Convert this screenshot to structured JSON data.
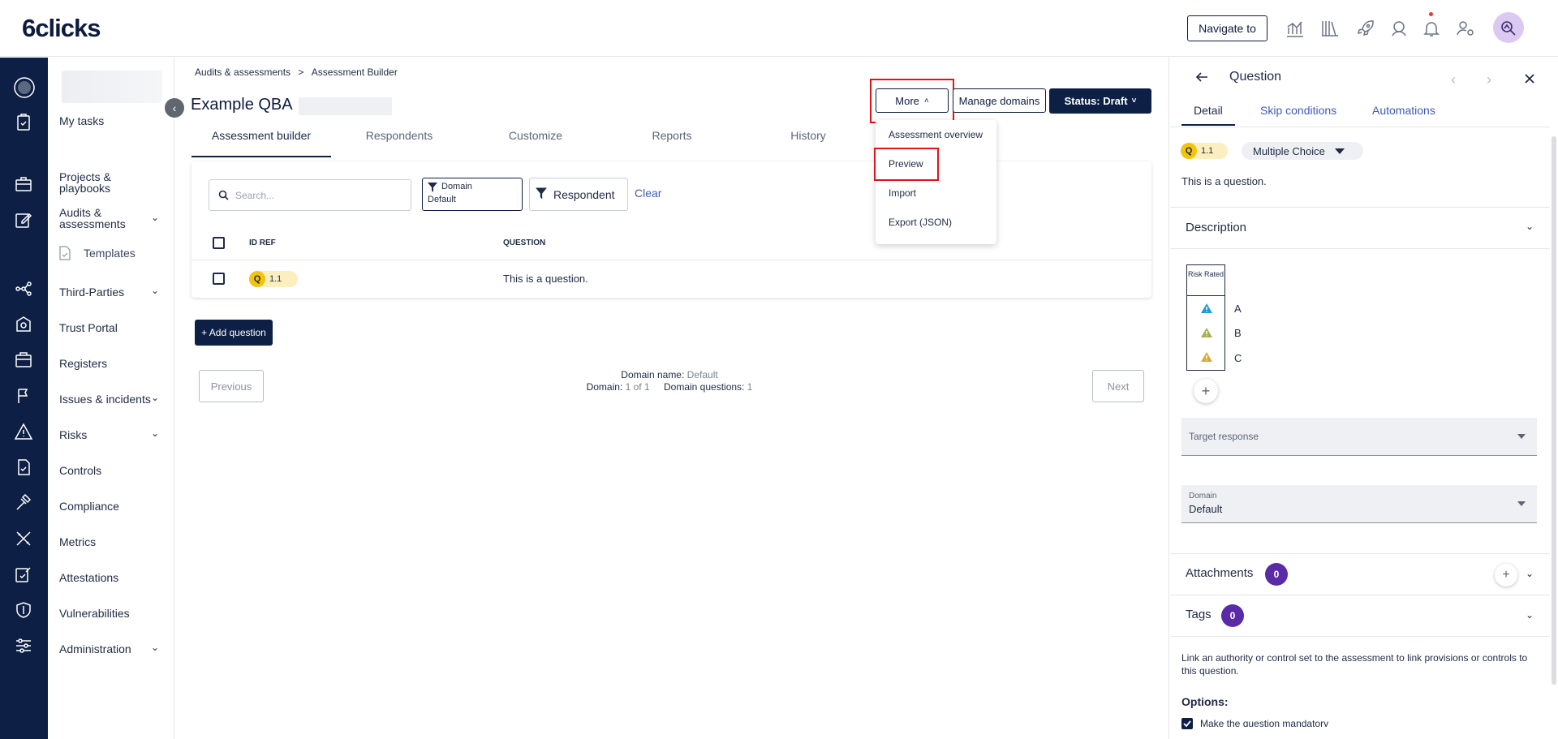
{
  "header": {
    "logo": "6clicks",
    "navigate_label": "Navigate to"
  },
  "menu": {
    "my_tasks": "My tasks",
    "projects": "Projects & playbooks",
    "audits": "Audits & assessments",
    "templates": "Templates",
    "third_parties": "Third-Parties",
    "trust_portal": "Trust Portal",
    "registers": "Registers",
    "issues": "Issues & incidents",
    "risks": "Risks",
    "controls": "Controls",
    "compliance": "Compliance",
    "metrics": "Metrics",
    "attestations": "Attestations",
    "vulnerabilities": "Vulnerabilities",
    "administration": "Administration"
  },
  "breadcrumb": {
    "parent": "Audits & assessments",
    "separator": ">",
    "current": "Assessment Builder"
  },
  "page": {
    "title": "Example QBA",
    "more_label": "More",
    "manage_domains_label": "Manage domains",
    "status_label": "Status: Draft"
  },
  "tabs": [
    "Assessment builder",
    "Respondents",
    "Customize",
    "Reports",
    "History"
  ],
  "filters": {
    "search_placeholder": "Search...",
    "domain_label": "Domain",
    "domain_value": "Default",
    "respondent_label": "Respondent",
    "clear_label": "Clear"
  },
  "table": {
    "columns": [
      "ID REF",
      "QUESTION"
    ],
    "rows": [
      {
        "badge": "Q",
        "id": "1.1",
        "question": "This is a question."
      }
    ]
  },
  "add_question_label": "+ Add question",
  "pagination": {
    "previous": "Previous",
    "next": "Next",
    "domain_name_label": "Domain name:",
    "domain_name_value": "Default",
    "domain_label": "Domain:",
    "domain_value": "1 of 1",
    "domain_questions_label": "Domain questions:",
    "domain_questions_value": "1"
  },
  "more_menu": {
    "items": [
      "Assessment overview",
      "Preview",
      "Import",
      "Export (JSON)"
    ]
  },
  "panel": {
    "title": "Question",
    "tabs": [
      "Detail",
      "Skip conditions",
      "Automations"
    ],
    "badge": "Q",
    "id": "1.1",
    "question_type": "Multiple Choice",
    "question_text": "This is a question.",
    "description_label": "Description",
    "risk_rated_label": "Risk Rated",
    "answers": [
      "A",
      "B",
      "C"
    ],
    "answer_icon_colors": [
      "#1e9bd7",
      "#a8b04a",
      "#d9a93a"
    ],
    "target_response_label": "Target response",
    "domain_field_label": "Domain",
    "domain_field_value": "Default",
    "attachments_label": "Attachments",
    "attachments_count": "0",
    "tags_label": "Tags",
    "tags_count": "0",
    "link_text": "Link an authority or control set to the assessment to link provisions or controls to this question.",
    "options_label": "Options:",
    "mandatory_label": "Make the question mandatory"
  },
  "colors": {
    "navy": "#0d1f44",
    "highlight_red": "#e0131a",
    "badge_purple": "#5b2aa6",
    "q_yellow": "#f2c40d"
  }
}
